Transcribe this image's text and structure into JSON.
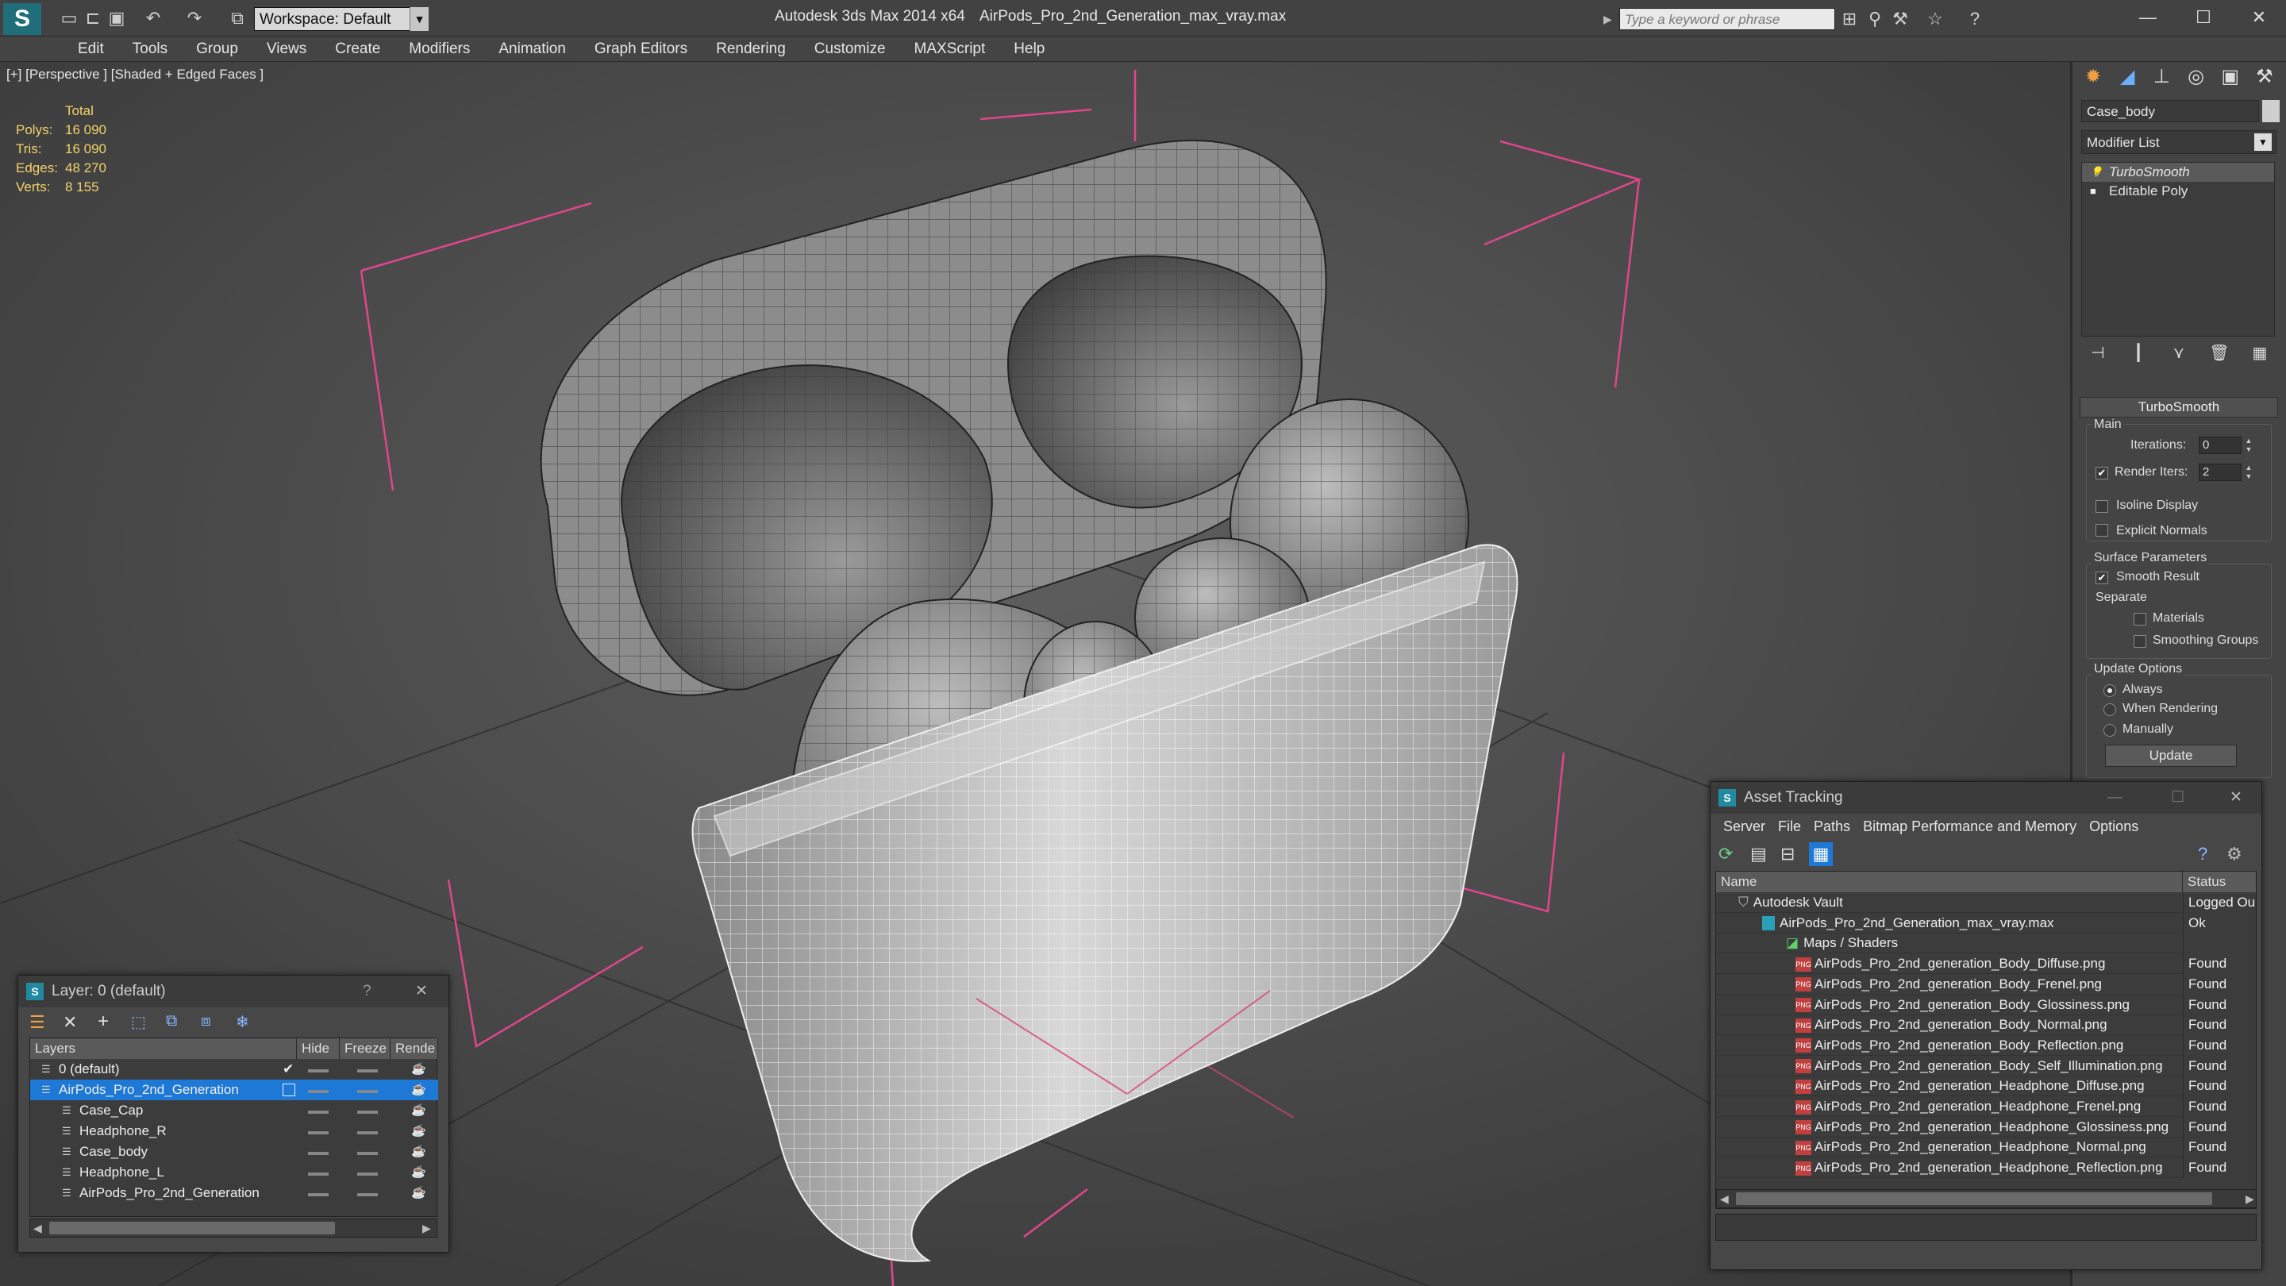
{
  "titlebar": {
    "app_title": "Autodesk 3ds Max  2014 x64",
    "file_title": "AirPods_Pro_2nd_Generation_max_vray.max",
    "workspace_label": "Workspace: Default",
    "search_placeholder": "Type a keyword or phrase",
    "icons": [
      "new-icon",
      "open-icon",
      "save-icon",
      "undo-icon",
      "redo-icon",
      "project-icon"
    ],
    "tool_icons": [
      "binoculars-icon",
      "key-icon",
      "tools-icon",
      "star-icon",
      "help-icon"
    ],
    "window_buttons": [
      "minimize",
      "maximize",
      "close"
    ]
  },
  "menu": {
    "items": [
      "Edit",
      "Tools",
      "Group",
      "Views",
      "Create",
      "Modifiers",
      "Animation",
      "Graph Editors",
      "Rendering",
      "Customize",
      "MAXScript",
      "Help"
    ]
  },
  "viewport": {
    "label": "[+] [Perspective ] [Shaded + Edged Faces ]",
    "stats": {
      "header": "Total",
      "rows": [
        {
          "key": "Polys:",
          "value": "16 090"
        },
        {
          "key": "Tris:",
          "value": "16 090"
        },
        {
          "key": "Edges:",
          "value": "48 270"
        },
        {
          "key": "Verts:",
          "value": "8 155"
        }
      ]
    }
  },
  "command_panel": {
    "tabs": [
      "create-icon",
      "modify-icon",
      "hierarchy-icon",
      "motion-icon",
      "display-icon",
      "utilities-icon"
    ],
    "object_name": "Case_body",
    "modifier_list": "Modifier List",
    "stack": [
      {
        "label": "TurboSmooth",
        "selected": true
      },
      {
        "label": "Editable Poly",
        "selected": false
      }
    ],
    "turbosmooth": {
      "title": "TurboSmooth",
      "main_label": "Main",
      "iterations_label": "Iterations:",
      "iterations_value": "0",
      "render_iters_label": "Render Iters:",
      "render_iters_value": "2",
      "render_iters_checked": true,
      "isoline_label": "Isoline Display",
      "explicit_normals_label": "Explicit Normals",
      "surface_params_label": "Surface Parameters",
      "smooth_result_label": "Smooth Result",
      "separate_label": "Separate",
      "materials_label": "Materials",
      "smoothing_groups_label": "Smoothing Groups",
      "update_options_label": "Update Options",
      "always_label": "Always",
      "when_rendering_label": "When Rendering",
      "manually_label": "Manually",
      "update_button": "Update"
    }
  },
  "layer_window": {
    "title": "Layer: 0 (default)",
    "help": "?",
    "columns": [
      "Layers",
      "Hide",
      "Freeze",
      "Rende"
    ],
    "rows": [
      {
        "name": "0 (default)",
        "indent": 1,
        "selected": false,
        "active": true
      },
      {
        "name": "AirPods_Pro_2nd_Generation",
        "indent": 1,
        "selected": true,
        "active": false
      },
      {
        "name": "Case_Cap",
        "indent": 2,
        "selected": false,
        "active": false
      },
      {
        "name": "Headphone_R",
        "indent": 2,
        "selected": false,
        "active": false
      },
      {
        "name": "Case_body",
        "indent": 2,
        "selected": false,
        "active": false
      },
      {
        "name": "Headphone_L",
        "indent": 2,
        "selected": false,
        "active": false
      },
      {
        "name": "AirPods_Pro_2nd_Generation",
        "indent": 2,
        "selected": false,
        "active": false
      }
    ]
  },
  "asset_window": {
    "title": "Asset Tracking",
    "menu": [
      "Server",
      "File",
      "Paths",
      "Bitmap Performance and Memory",
      "Options"
    ],
    "columns": [
      "Name",
      "Status"
    ],
    "rows": [
      {
        "name": "Autodesk Vault",
        "status": "Logged Ou",
        "level": 0,
        "type": "vault"
      },
      {
        "name": "AirPods_Pro_2nd_Generation_max_vray.max",
        "status": "Ok",
        "level": 1,
        "type": "max"
      },
      {
        "name": "Maps / Shaders",
        "status": "",
        "level": 2,
        "type": "maps"
      },
      {
        "name": "AirPods_Pro_2nd_generation_Body_Diffuse.png",
        "status": "Found",
        "level": 3,
        "type": "png"
      },
      {
        "name": "AirPods_Pro_2nd_generation_Body_Frenel.png",
        "status": "Found",
        "level": 3,
        "type": "png"
      },
      {
        "name": "AirPods_Pro_2nd_generation_Body_Glossiness.png",
        "status": "Found",
        "level": 3,
        "type": "png"
      },
      {
        "name": "AirPods_Pro_2nd_generation_Body_Normal.png",
        "status": "Found",
        "level": 3,
        "type": "png"
      },
      {
        "name": "AirPods_Pro_2nd_generation_Body_Reflection.png",
        "status": "Found",
        "level": 3,
        "type": "png"
      },
      {
        "name": "AirPods_Pro_2nd_generation_Body_Self_Illumination.png",
        "status": "Found",
        "level": 3,
        "type": "png"
      },
      {
        "name": "AirPods_Pro_2nd_generation_Headphone_Diffuse.png",
        "status": "Found",
        "level": 3,
        "type": "png"
      },
      {
        "name": "AirPods_Pro_2nd_generation_Headphone_Frenel.png",
        "status": "Found",
        "level": 3,
        "type": "png"
      },
      {
        "name": "AirPods_Pro_2nd_generation_Headphone_Glossiness.png",
        "status": "Found",
        "level": 3,
        "type": "png"
      },
      {
        "name": "AirPods_Pro_2nd_generation_Headphone_Normal.png",
        "status": "Found",
        "level": 3,
        "type": "png"
      },
      {
        "name": "AirPods_Pro_2nd_generation_Headphone_Reflection.png",
        "status": "Found",
        "level": 3,
        "type": "png"
      }
    ]
  },
  "colors": {
    "accent_orange": "#f0a040",
    "stat_yellow": "#f2d36b",
    "selection_blue": "#1e78d6",
    "grid_pink": "#d9447a",
    "bbox_pink": "#e0468c"
  }
}
